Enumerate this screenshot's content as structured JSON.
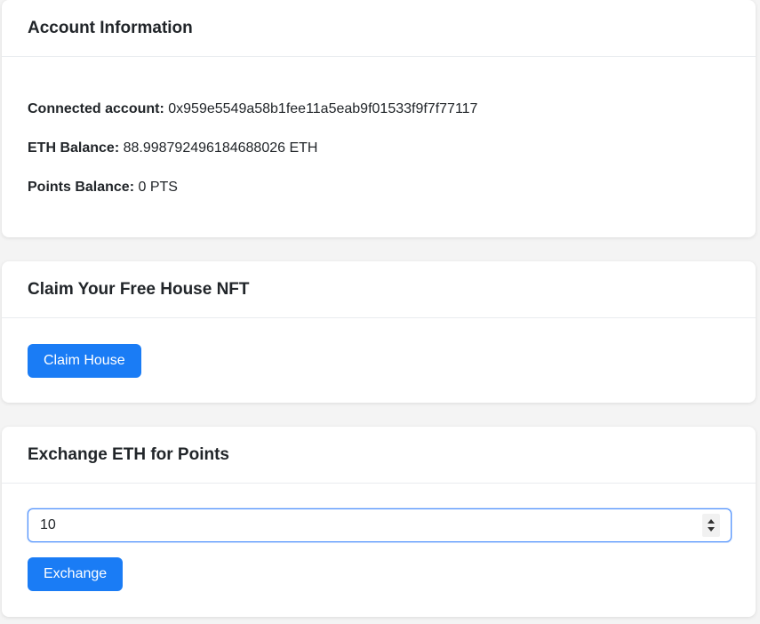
{
  "account": {
    "title": "Account Information",
    "connected_label": "Connected account:",
    "connected_value": "0x959e5549a58b1fee11a5eab9f01533f9f7f77117",
    "eth_label": "ETH Balance:",
    "eth_value": "88.998792496184688026 ETH",
    "points_label": "Points Balance:",
    "points_value": "0 PTS"
  },
  "claim": {
    "title": "Claim Your Free House NFT",
    "button_label": "Claim House"
  },
  "exchange": {
    "title": "Exchange ETH for Points",
    "input_value": "10",
    "button_label": "Exchange"
  },
  "colors": {
    "primary": "#1a7cf5",
    "background": "#f4f4f4",
    "card": "#ffffff"
  }
}
